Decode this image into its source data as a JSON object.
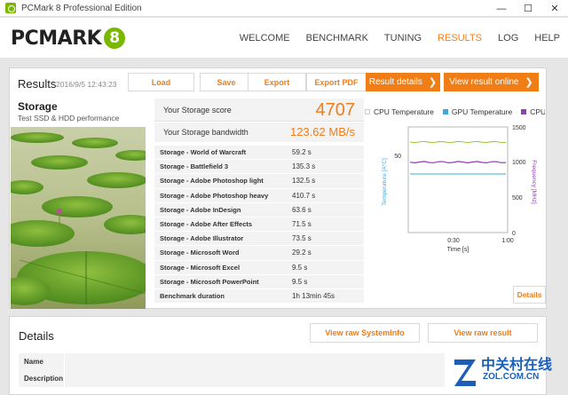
{
  "window": {
    "title": "PCMark 8 Professional Edition",
    "minimize": "—",
    "maximize": "☐",
    "close": "✕"
  },
  "logo": {
    "word": "PCMARK",
    "badge": "8"
  },
  "nav": {
    "items": [
      "WELCOME",
      "BENCHMARK",
      "TUNING",
      "RESULTS",
      "LOG",
      "HELP"
    ],
    "active": "RESULTS"
  },
  "results": {
    "title": "Results",
    "date": "2016/9/5 12:43:23",
    "buttons": {
      "load": "Load",
      "save": "Save",
      "export": "Export",
      "export_pdf": "Export PDF"
    },
    "result_details": "Result details",
    "view_online": "View result online",
    "test_name": "Storage",
    "test_desc": "Test SSD & HDD performance",
    "score_label": "Your Storage score",
    "score_value": "4707",
    "bandwidth_label": "Your Storage bandwidth",
    "bandwidth_value": "123.62 MB/s",
    "rows": [
      {
        "name": "Storage - World of Warcraft",
        "value": "59.2 s"
      },
      {
        "name": "Storage - Battlefield 3",
        "value": "135.3 s"
      },
      {
        "name": "Storage - Adobe Photoshop light",
        "value": "132.5 s"
      },
      {
        "name": "Storage - Adobe Photoshop heavy",
        "value": "410.7 s"
      },
      {
        "name": "Storage - Adobe InDesign",
        "value": "63.6 s"
      },
      {
        "name": "Storage - Adobe After Effects",
        "value": "71.5 s"
      },
      {
        "name": "Storage - Adobe Illustrator",
        "value": "73.5 s"
      },
      {
        "name": "Storage - Microsoft Word",
        "value": "29.2 s"
      },
      {
        "name": "Storage - Microsoft Excel",
        "value": "9.5 s"
      },
      {
        "name": "Storage - Microsoft PowerPoint",
        "value": "9.5 s"
      },
      {
        "name": "Benchmark duration",
        "value": "1h 13min 45s"
      }
    ]
  },
  "monitor": {
    "legend": [
      {
        "name": "CPU Temperature",
        "color": "#ffffff"
      },
      {
        "name": "GPU Temperature",
        "color": "#3ca9dc"
      },
      {
        "name": "CPU Clo",
        "color": "#8e3fb0"
      }
    ],
    "left_axis_label": "Temperature [A°C]",
    "right_axis_label": "Frequency [MHz]",
    "x_label": "Time [s]",
    "left_ticks": [
      "50"
    ],
    "right_ticks": [
      "1500",
      "1000",
      "500",
      "0"
    ],
    "x_ticks": [
      "0:30",
      "1:00"
    ],
    "details": "Details",
    "series": {
      "gpu_temp_c": 43,
      "cpu_temp_c": 55,
      "cpu_clock_mhz": 1000
    }
  },
  "details": {
    "title": "Details",
    "view_sysinfo": "View raw SystemInfo",
    "view_result": "View raw result",
    "rows": [
      "Name",
      "Description"
    ]
  },
  "watermark": {
    "cn": "中关村在线",
    "en": "ZOL.COM.CN"
  },
  "colors": {
    "accent": "#ef7d1a",
    "brand_green": "#7ab800"
  }
}
